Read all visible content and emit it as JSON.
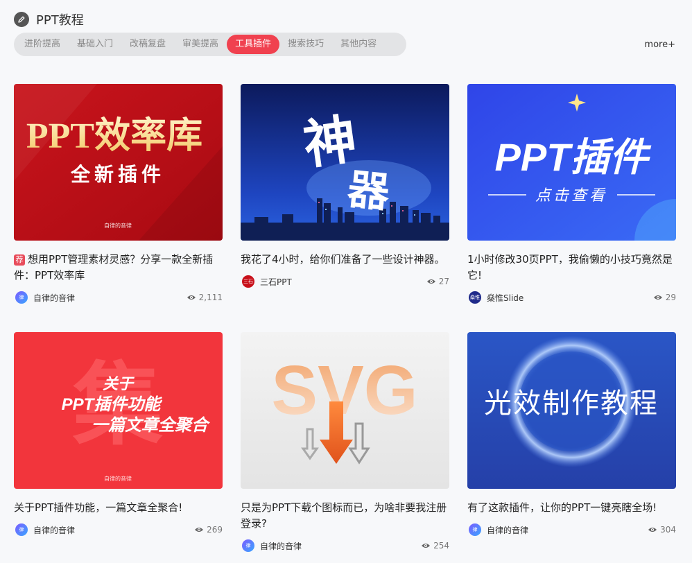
{
  "header": {
    "title": "PPT教程",
    "icon": "pencil-icon"
  },
  "tabs": [
    {
      "label": "进阶提高",
      "active": false
    },
    {
      "label": "基础入门",
      "active": false
    },
    {
      "label": "改稿复盘",
      "active": false
    },
    {
      "label": "审美提高",
      "active": false
    },
    {
      "label": "工具插件",
      "active": true
    },
    {
      "label": "搜索技巧",
      "active": false
    },
    {
      "label": "其他内容",
      "active": false
    }
  ],
  "more_label": "more+",
  "accent_color": "#f0414f",
  "cards": [
    {
      "tag": "荐",
      "title": "想用PPT管理素材灵感？分享一款全新插件：PPT效率库",
      "author": "自律的音律",
      "avatar_text": "律",
      "views": "2,111",
      "thumb": {
        "line1": "PPT效率库",
        "line2": "全新插件",
        "small": "自律的音律"
      }
    },
    {
      "title": "我花了4小时，给你们准备了一些设计神器。",
      "author": "三石PPT",
      "avatar_text": "三石",
      "views": "27",
      "thumb": {
        "line1": "神",
        "line2": "器"
      }
    },
    {
      "title": "1小时修改30页PPT，我偷懒的小技巧竟然是它!",
      "author": "燊惟Slide",
      "avatar_text": "燊惟",
      "views": "29",
      "thumb": {
        "line1": "PPT插件",
        "line2": "点击查看"
      }
    },
    {
      "title": "关于PPT插件功能，一篇文章全聚合!",
      "author": "自律的音律",
      "avatar_text": "律",
      "views": "269",
      "thumb": {
        "line1": "关于",
        "line2": "PPT插件功能",
        "line3": "一篇文章全聚合",
        "bg_char": "集",
        "small": "自律的音律"
      }
    },
    {
      "title": "只是为PPT下载个图标而已，为啥非要我注册登录?",
      "author": "自律的音律",
      "avatar_text": "律",
      "views": "254",
      "thumb": {
        "line1": "SVG"
      }
    },
    {
      "title": "有了这款插件，让你的PPT一键亮瞎全场!",
      "author": "自律的音律",
      "avatar_text": "律",
      "views": "304",
      "thumb": {
        "line1": "光效制作教程"
      }
    }
  ]
}
